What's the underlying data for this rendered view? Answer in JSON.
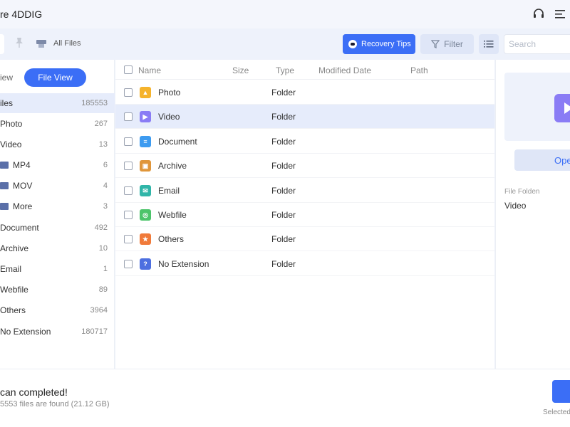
{
  "titlebar": {
    "title": "re 4DDIG",
    "support_icon": "headset-icon",
    "menu_icon": "menu-icon"
  },
  "toolbar": {
    "breadcrumb": "All Files",
    "recovery_tips": "Recovery Tips",
    "filter": "Filter",
    "search_placeholder": "Search"
  },
  "sidebar": {
    "tree_view_label": "iew",
    "file_view_label": "File View",
    "items": [
      {
        "label": "iles",
        "count": "185553"
      },
      {
        "label": "Photo",
        "count": "267"
      },
      {
        "label": "Video",
        "count": "13"
      },
      {
        "label": "MP4",
        "count": "6"
      },
      {
        "label": "MOV",
        "count": "4"
      },
      {
        "label": "More",
        "count": "3"
      },
      {
        "label": "Document",
        "count": "492"
      },
      {
        "label": "Archive",
        "count": "10"
      },
      {
        "label": "Email",
        "count": "1"
      },
      {
        "label": "Webfile",
        "count": "89"
      },
      {
        "label": "Others",
        "count": "3964"
      },
      {
        "label": "No Extension",
        "count": "180717"
      }
    ]
  },
  "list": {
    "headers": {
      "name": "Name",
      "size": "Size",
      "type": "Type",
      "modified": "Modified Date",
      "path": "Path"
    },
    "rows": [
      {
        "name": "Photo",
        "type": "Folder",
        "icon": "photo-icon",
        "color": "#f5b32c"
      },
      {
        "name": "Video",
        "type": "Folder",
        "icon": "video-icon",
        "color": "#8a7cf5"
      },
      {
        "name": "Document",
        "type": "Folder",
        "icon": "document-icon",
        "color": "#3d9bf0"
      },
      {
        "name": "Archive",
        "type": "Folder",
        "icon": "archive-icon",
        "color": "#e0963a"
      },
      {
        "name": "Email",
        "type": "Folder",
        "icon": "email-icon",
        "color": "#30b5a8"
      },
      {
        "name": "Webfile",
        "type": "Folder",
        "icon": "webfile-icon",
        "color": "#4cc46a"
      },
      {
        "name": "Others",
        "type": "Folder",
        "icon": "others-icon",
        "color": "#f07a3a"
      },
      {
        "name": "No Extension",
        "type": "Folder",
        "icon": "no-extension-icon",
        "color": "#4d6fe0"
      }
    ]
  },
  "preview": {
    "open_label": "Ope",
    "folder_label": "File Folden",
    "folder_value": "Video"
  },
  "footer": {
    "status": "can completed!",
    "detail": "5553 files are found (21.12 GB)",
    "selected": "Selected"
  },
  "colors": {
    "accent": "#3b6ef6",
    "selected_row": "#e6ecfb"
  }
}
